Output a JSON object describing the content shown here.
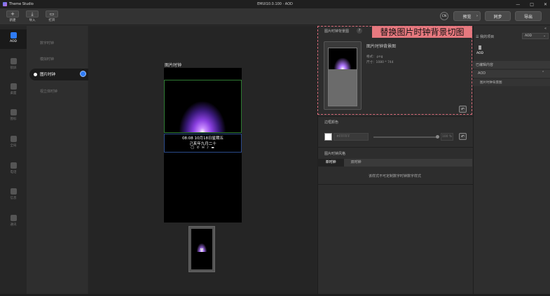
{
  "app": {
    "name": "Theme Studio",
    "document": "EMUI10.0.100 · AOD"
  },
  "window_controls": [
    "—",
    "□",
    "✕"
  ],
  "toolbar": {
    "new_label": "新建",
    "import_label": "导入",
    "open_label": "打开",
    "lang": "CN",
    "preview_label": "预览",
    "sync_label": "同步",
    "export_label": "导出"
  },
  "rail": [
    "AOD",
    "锁屏",
    "桌面",
    "图标",
    "全局",
    "电话",
    "信息",
    "通讯"
  ],
  "clock_list": {
    "items": [
      "数字时钟",
      "模拟时钟"
    ],
    "active": "图片时钟",
    "after": "视立体时钟"
  },
  "preview": {
    "title": "图片时钟",
    "time_line": "08:08  10月18日星期五",
    "lunar_line": "己亥年九月二十",
    "status_icons": "◯ ✆ ✉ ♪ ▬"
  },
  "props": {
    "section_title": "图片时钟背景图",
    "help": "?",
    "banner": "替换图片时钟背景切图",
    "image_name": "图片时钟背景图",
    "format": "格式：.png",
    "size": "尺寸：1080 * 744",
    "color_section": "边框颜色",
    "hex_value": "#FFFFFF",
    "opacity": "100 %",
    "style_section": "图片时钟风格",
    "tab_single": "单时钟",
    "tab_dual": "双时钟",
    "note": "该样式不可定制数字时钟数字样式"
  },
  "right_panel": {
    "my_items": "我的项目",
    "select_value": "AOD",
    "item_label": "AOD",
    "edited_header": "已编辑内容",
    "edited_group": "AOD",
    "edited_item": "图片时钟背景图",
    "collapse": "«"
  }
}
